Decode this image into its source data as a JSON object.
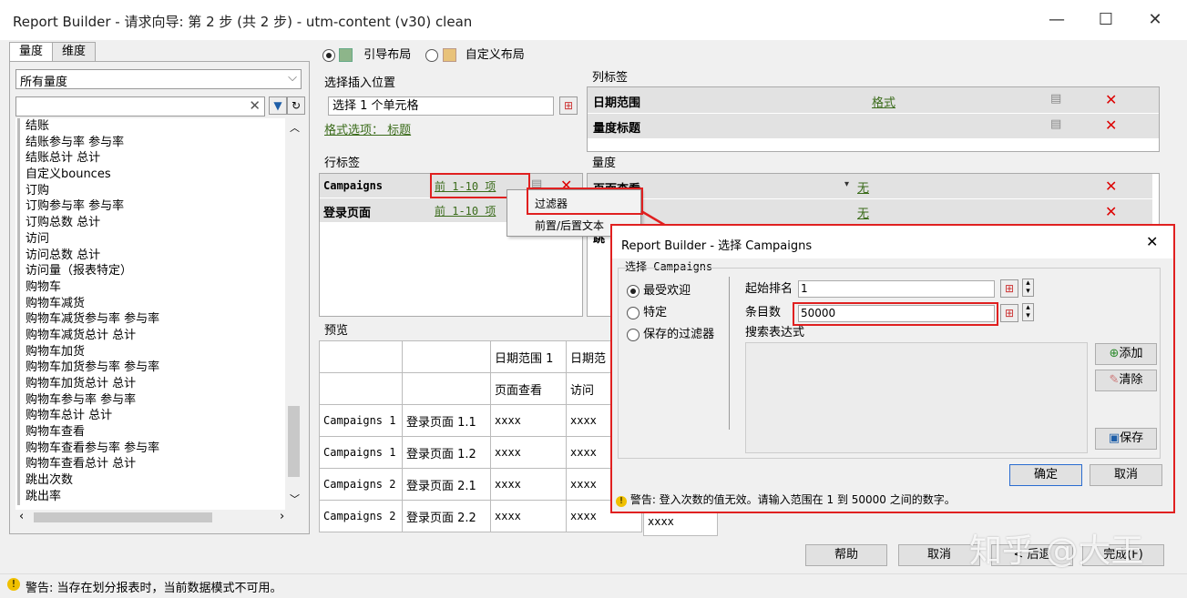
{
  "window": {
    "title": "Report Builder - 请求向导: 第 2 步 (共 2 步)  - utm-content (v30) clean",
    "min": "—",
    "max": "☐",
    "close": "✕"
  },
  "left": {
    "tabs": [
      "量度",
      "维度"
    ],
    "dropdown": "所有量度",
    "search_value": "",
    "items": [
      "结账",
      "结账参与率 参与率",
      "结账总计 总计",
      "自定义bounces",
      "订购",
      "订购参与率 参与率",
      "订购总数 总计",
      "访问",
      "访问总数 总计",
      "访问量（报表特定）",
      "购物车",
      "购物车减货",
      "购物车减货参与率 参与率",
      "购物车减货总计 总计",
      "购物车加货",
      "购物车加货参与率 参与率",
      "购物车加货总计 总计",
      "购物车参与率 参与率",
      "购物车总计 总计",
      "购物车查看",
      "购物车查看参与率 参与率",
      "购物车查看总计 总计",
      "跳出次数",
      "跳出率"
    ]
  },
  "layout": {
    "guided": "引导布局",
    "custom": "自定义布局"
  },
  "insert": {
    "label": "选择插入位置",
    "value": "选择 1 个单元格",
    "format_link": "格式选项： 标题"
  },
  "col_labels": {
    "title": "列标签",
    "rows": [
      {
        "name": "日期范围",
        "link": "格式"
      },
      {
        "name": "量度标题",
        "link": ""
      }
    ]
  },
  "row_labels": {
    "title": "行标签",
    "rows": [
      {
        "name": "Campaigns",
        "link": "前 1-10 项"
      },
      {
        "name": "登录页面",
        "link": "前 1-10 项"
      }
    ]
  },
  "metrics": {
    "title": "量度",
    "rows": [
      {
        "name": "页面查看",
        "link": "无"
      },
      {
        "name": "",
        "link": "无"
      }
    ],
    "partial": "跳"
  },
  "context_menu": {
    "items": [
      "过滤器",
      "前置/后置文本"
    ]
  },
  "preview": {
    "title": "预览",
    "header1": [
      "",
      "",
      "日期范围 1",
      "日期范"
    ],
    "header2": [
      "",
      "",
      "页面查看",
      "访问"
    ],
    "rows": [
      [
        "Campaigns 1",
        "登录页面 1.1",
        "xxxx",
        "xxxx",
        ""
      ],
      [
        "Campaigns 1",
        "登录页面 1.2",
        "xxxx",
        "xxxx",
        ""
      ],
      [
        "Campaigns 2",
        "登录页面 2.1",
        "xxxx",
        "xxxx",
        ""
      ],
      [
        "Campaigns 2",
        "登录页面 2.2",
        "xxxx",
        "xxxx",
        "xxxx"
      ]
    ]
  },
  "dialog": {
    "title": "Report Builder - 选择 Campaigns",
    "group": "选择 Campaigns",
    "options": [
      "最受欢迎",
      "特定",
      "保存的过滤器"
    ],
    "start_label": "起始排名",
    "start_value": "1",
    "count_label": "条目数",
    "count_value": "50000",
    "expr_label": "搜索表达式",
    "add": "添加",
    "clear": "清除",
    "save": "保存",
    "ok": "确定",
    "cancel": "取消",
    "warning": "警告:  登入次数的值无效。请输入范围在 1 到 50000 之间的数字。"
  },
  "footer": {
    "help": "帮助",
    "cancel": "取消",
    "back": "< 后退",
    "finish": "完成(F)"
  },
  "status_warning": "警告:  当存在划分报表时，当前数据模式不可用。",
  "watermark": "知乎 @大王"
}
